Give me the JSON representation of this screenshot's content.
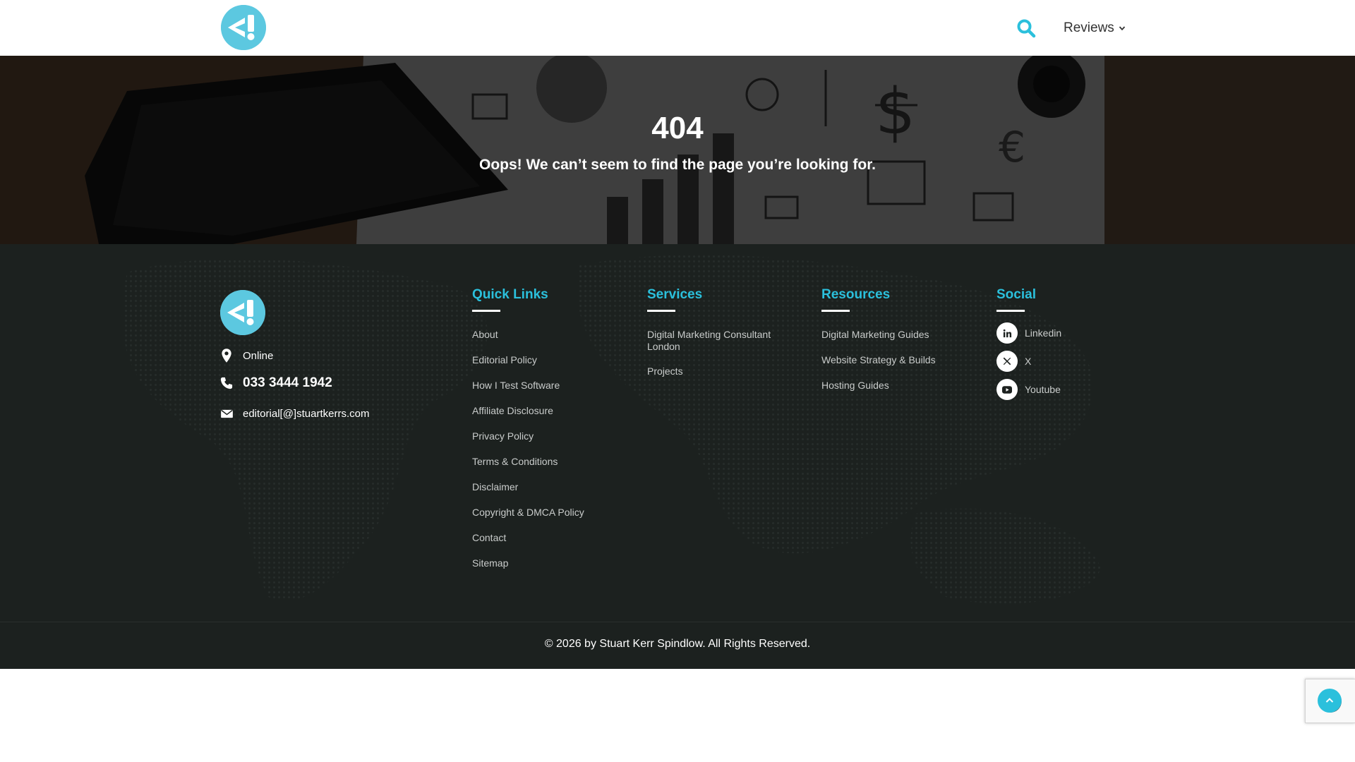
{
  "header": {
    "logo_icon": "site-logo-icon",
    "search_icon": "search-icon",
    "nav": {
      "reviews_label": "Reviews"
    }
  },
  "hero": {
    "title": "404",
    "subtitle": "Oops! We can’t seem to find the page you’re looking for."
  },
  "footer": {
    "contact": {
      "location": "Online",
      "phone": "033 3444 1942",
      "email": "editorial[@]stuartkerrs.com"
    },
    "quick_links": {
      "heading": "Quick Links",
      "items": [
        "About",
        "Editorial Policy",
        "How I Test Software",
        "Affiliate Disclosure",
        "Privacy Policy",
        "Terms & Conditions",
        "Disclaimer",
        "Copyright & DMCA Policy",
        "Contact",
        "Sitemap"
      ]
    },
    "services": {
      "heading": "Services",
      "items": [
        "Digital Marketing Consultant London",
        "Projects"
      ]
    },
    "resources": {
      "heading": "Resources",
      "items": [
        "Digital Marketing Guides",
        "Website Strategy & Builds",
        "Hosting Guides"
      ]
    },
    "social": {
      "heading": "Social",
      "items": [
        "Linkedin",
        "X",
        "Youtube"
      ]
    },
    "copyright": "© 2026 by Stuart Kerr Spindlow. All Rights Reserved."
  },
  "colors": {
    "accent": "#2bc0dc",
    "logo": "#5cc8e0",
    "footer_bg": "#1c211f"
  }
}
